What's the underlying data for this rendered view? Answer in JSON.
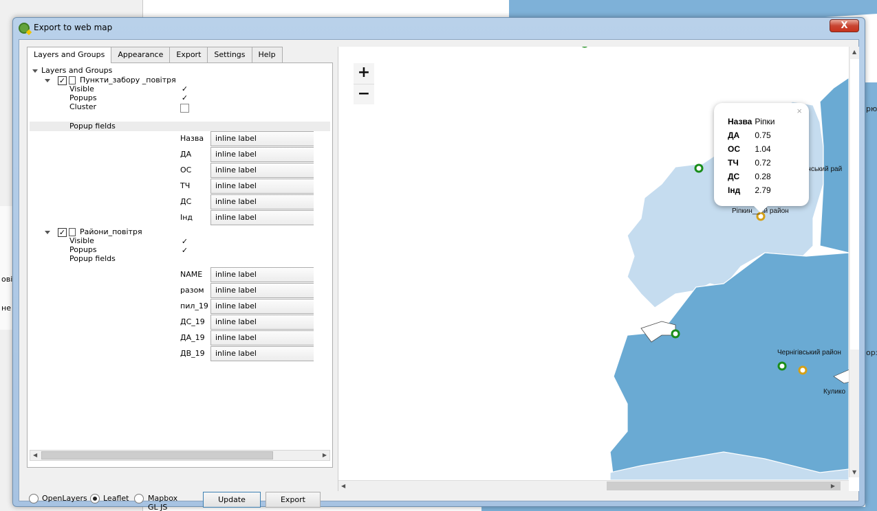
{
  "window": {
    "title": "Export to web map",
    "close_glyph": "X"
  },
  "tabs": [
    "Layers and Groups",
    "Appearance",
    "Export",
    "Settings",
    "Help"
  ],
  "tree": {
    "root": "Layers and Groups",
    "layer1": {
      "name": "Пункти_забору _повітря",
      "checked": true,
      "visible_label": "Visible",
      "popups_label": "Popups",
      "cluster_label": "Cluster",
      "popup_fields_label": "Popup fields",
      "fields": [
        {
          "name": "Назва",
          "value": "inline label"
        },
        {
          "name": "ДА",
          "value": "inline label"
        },
        {
          "name": "ОС",
          "value": "inline label"
        },
        {
          "name": "ТЧ",
          "value": "inline label"
        },
        {
          "name": "ДС",
          "value": "inline label"
        },
        {
          "name": "Інд",
          "value": "inline label"
        }
      ]
    },
    "layer2": {
      "name": "Райони_повітря",
      "checked": true,
      "visible_label": "Visible",
      "popups_label": "Popups",
      "popup_fields_label": "Popup fields",
      "fields": [
        {
          "name": "NAME",
          "value": "inline label"
        },
        {
          "name": "разом",
          "value": "inline label"
        },
        {
          "name": "пил_19",
          "value": "inline label"
        },
        {
          "name": "ДС_19",
          "value": "inline label"
        },
        {
          "name": "ДА_19",
          "value": "inline label"
        },
        {
          "name": "ДВ_19",
          "value": "inline label"
        }
      ]
    }
  },
  "bottom": {
    "radio_openlayers": "OpenLayers",
    "radio_leaflet": "Leaflet",
    "radio_mapbox": "Mapbox GL JS",
    "selected": "Leaflet",
    "update_preview": "Update preview",
    "export": "Export"
  },
  "map": {
    "zoom_in": "+",
    "zoom_out": "−",
    "labels": {
      "ripky": "Ріпкин__ий район",
      "chernihiv": "Чернігівський район",
      "kulykiv": "Кулико",
      "ripky_upper": "янський рай"
    },
    "popup": {
      "rows": [
        {
          "k": "Назва",
          "v": "Ріпки"
        },
        {
          "k": "ДА",
          "v": "0.75"
        },
        {
          "k": "ОС",
          "v": "1.04"
        },
        {
          "k": "ТЧ",
          "v": "0.72"
        },
        {
          "k": "ДС",
          "v": "0.28"
        },
        {
          "k": "Інд",
          "v": "2.79"
        }
      ],
      "close": "×"
    }
  },
  "background": {
    "side_text": [
      "рю",
      "орз"
    ],
    "left_text": [
      "овi",
      "не"
    ]
  }
}
